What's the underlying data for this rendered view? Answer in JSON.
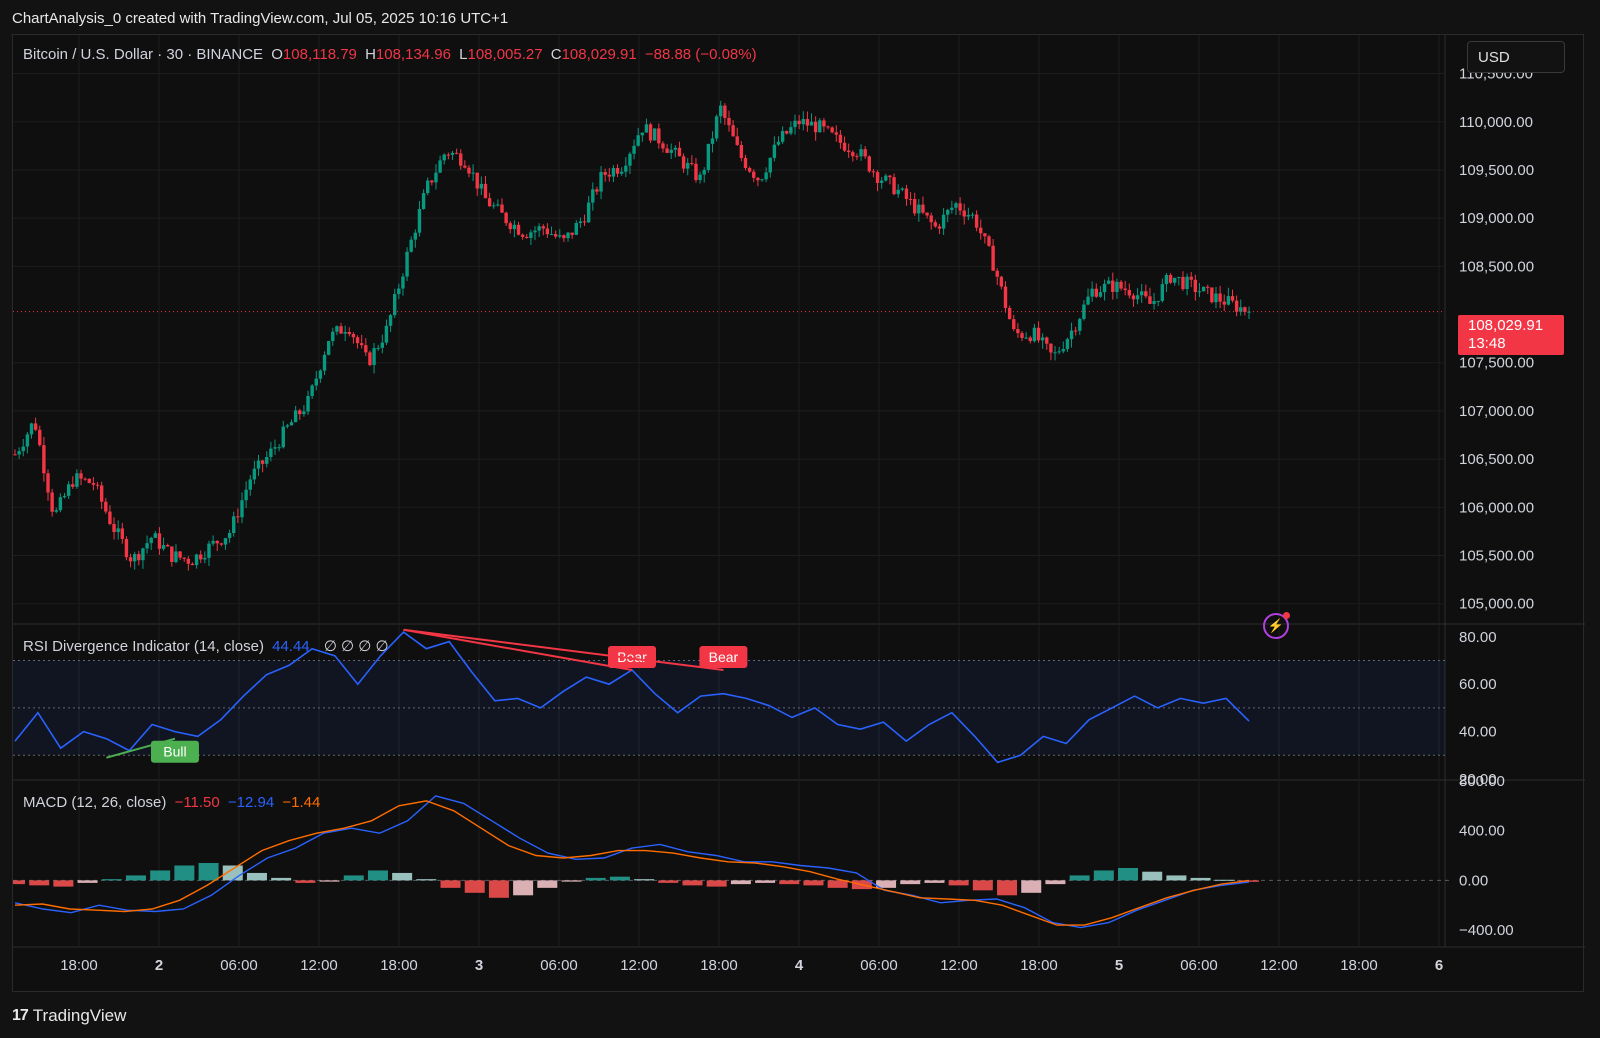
{
  "caption": "ChartAnalysis_0 created with TradingView.com, Jul 05, 2025 10:16 UTC+1",
  "currency": "USD",
  "footer": {
    "brand": "TradingView"
  },
  "main_legend": {
    "symbol": "Bitcoin / U.S. Dollar · 30 · BINANCE",
    "o_label": "O",
    "o_value": "108,118.79",
    "h_label": "H",
    "h_value": "108,134.96",
    "l_label": "L",
    "l_value": "108,005.27",
    "c_label": "C",
    "c_value": "108,029.91",
    "change": "−88.88 (−0.08%)"
  },
  "price_tag": {
    "price": "108,029.91",
    "countdown": "13:48"
  },
  "rsi_legend": {
    "name": "RSI Divergence Indicator (14, close)",
    "value": "44.44",
    "empty_marks": "∅ ∅ ∅ ∅"
  },
  "macd_legend": {
    "name": "MACD (12, 26, close)",
    "hist": "−11.50",
    "macd": "−12.94",
    "signal": "−1.44"
  },
  "colors": {
    "up": "#089981",
    "down": "#f23645",
    "rsi": "#2962ff",
    "macd": "#2962ff",
    "signal": "#ff6d00",
    "bull": "#4caf50",
    "bear": "#f23645"
  },
  "chart_data": [
    {
      "type": "candlestick",
      "title": "Bitcoin / U.S. Dollar · 30 · BINANCE",
      "x_tick_labels": [
        "18:00",
        "2",
        "06:00",
        "12:00",
        "18:00",
        "3",
        "06:00",
        "12:00",
        "18:00",
        "4",
        "06:00",
        "12:00",
        "18:00",
        "5",
        "06:00",
        "12:00",
        "18:00",
        "6"
      ],
      "y_tick_labels": [
        "110,500.00",
        "110,000.00",
        "109,500.00",
        "109,000.00",
        "108,500.00",
        "107,500.00",
        "107,000.00",
        "106,500.00",
        "106,000.00",
        "105,500.00",
        "105,000.00"
      ],
      "ylim": [
        104800,
        110900
      ],
      "last_price": 108029.91,
      "close_path": [
        [
          0,
          106550
        ],
        [
          1,
          106900
        ],
        [
          2,
          105900
        ],
        [
          3,
          106300
        ],
        [
          4,
          106250
        ],
        [
          5,
          105800
        ],
        [
          6,
          105450
        ],
        [
          7,
          105700
        ],
        [
          8,
          105500
        ],
        [
          9,
          105450
        ],
        [
          10,
          105600
        ],
        [
          11,
          105750
        ],
        [
          12,
          106300
        ],
        [
          13,
          106550
        ],
        [
          14,
          106850
        ],
        [
          15,
          107100
        ],
        [
          16,
          107750
        ],
        [
          17,
          107900
        ],
        [
          18,
          107500
        ],
        [
          19,
          107850
        ],
        [
          20,
          108600
        ],
        [
          21,
          109300
        ],
        [
          22,
          109700
        ],
        [
          23,
          109600
        ],
        [
          24,
          109200
        ],
        [
          25,
          109000
        ],
        [
          26,
          108850
        ],
        [
          27,
          108900
        ],
        [
          28,
          108750
        ],
        [
          29,
          109000
        ],
        [
          30,
          109450
        ],
        [
          31,
          109550
        ],
        [
          32,
          109950
        ],
        [
          33,
          109800
        ],
        [
          34,
          109600
        ],
        [
          35,
          109400
        ],
        [
          36,
          110150
        ],
        [
          37,
          109650
        ],
        [
          38,
          109400
        ],
        [
          39,
          109800
        ],
        [
          40,
          110000
        ],
        [
          41,
          109950
        ],
        [
          42,
          109800
        ],
        [
          43,
          109700
        ],
        [
          44,
          109450
        ],
        [
          45,
          109300
        ],
        [
          46,
          109100
        ],
        [
          47,
          108900
        ],
        [
          48,
          109150
        ],
        [
          49,
          109000
        ],
        [
          50,
          108500
        ],
        [
          51,
          107800
        ],
        [
          52,
          107800
        ],
        [
          53,
          107550
        ],
        [
          54,
          107850
        ],
        [
          55,
          108250
        ],
        [
          56,
          108300
        ],
        [
          57,
          108250
        ],
        [
          58,
          108100
        ],
        [
          59,
          108400
        ],
        [
          60,
          108300
        ],
        [
          61,
          108200
        ],
        [
          62,
          108120
        ],
        [
          63,
          108030
        ]
      ]
    },
    {
      "type": "line",
      "title": "RSI Divergence Indicator (14, close)",
      "y_tick_labels": [
        "80.00",
        "60.00",
        "40.00",
        "20.00"
      ],
      "ylim": [
        20,
        85
      ],
      "bands": [
        30,
        50,
        70
      ],
      "series": [
        {
          "name": "RSI",
          "values": [
            36,
            48,
            33,
            40,
            37,
            32,
            43,
            40,
            38,
            45,
            55,
            64,
            68,
            75,
            72,
            60,
            72,
            82,
            75,
            78,
            65,
            53,
            54,
            50,
            57,
            63,
            60,
            66,
            56,
            48,
            55,
            56,
            54,
            51,
            46,
            50,
            43,
            41,
            44,
            36,
            43,
            48,
            38,
            27,
            30,
            38,
            35,
            45,
            50,
            55,
            50,
            54,
            52,
            54,
            44.44
          ]
        }
      ],
      "divergences": [
        {
          "label": "Bull",
          "from": [
            4,
            29
          ],
          "to": [
            7,
            37
          ]
        },
        {
          "label": "Bear",
          "from": [
            17,
            83
          ],
          "to": [
            27,
            66
          ]
        },
        {
          "label": "Bear",
          "from": [
            17,
            83
          ],
          "to": [
            31,
            66
          ]
        }
      ]
    },
    {
      "type": "bar",
      "title": "MACD (12, 26, close)",
      "y_tick_labels": [
        "800.00",
        "400.00",
        "0.00",
        "−400.00"
      ],
      "ylim": [
        -520,
        800
      ],
      "series": [
        {
          "name": "Histogram",
          "values": [
            -30,
            -40,
            -50,
            -20,
            10,
            40,
            80,
            120,
            140,
            120,
            60,
            20,
            -20,
            -10,
            40,
            80,
            60,
            10,
            -60,
            -100,
            -140,
            -120,
            -60,
            -10,
            20,
            30,
            10,
            -20,
            -40,
            -50,
            -30,
            -20,
            -30,
            -40,
            -60,
            -70,
            -60,
            -30,
            -20,
            -40,
            -80,
            -120,
            -100,
            -30,
            40,
            80,
            100,
            70,
            40,
            20,
            5,
            -11.5
          ]
        },
        {
          "name": "MACD",
          "values": [
            -180,
            -230,
            -260,
            -200,
            -240,
            -250,
            -230,
            -120,
            40,
            180,
            260,
            380,
            420,
            380,
            480,
            680,
            620,
            480,
            340,
            220,
            170,
            180,
            260,
            290,
            230,
            200,
            150,
            150,
            120,
            100,
            60,
            -80,
            -120,
            -180,
            -160,
            -150,
            -220,
            -340,
            -380,
            -340,
            -240,
            -160,
            -80,
            -40,
            -12.94
          ]
        },
        {
          "name": "Signal",
          "values": [
            -200,
            -190,
            -230,
            -240,
            -250,
            -230,
            -160,
            -40,
            100,
            240,
            320,
            380,
            420,
            480,
            600,
            640,
            560,
            420,
            280,
            200,
            180,
            200,
            240,
            240,
            220,
            180,
            150,
            140,
            110,
            70,
            10,
            -40,
            -90,
            -140,
            -150,
            -160,
            -200,
            -280,
            -360,
            -360,
            -300,
            -220,
            -140,
            -80,
            -30,
            -1.44
          ]
        }
      ]
    }
  ]
}
